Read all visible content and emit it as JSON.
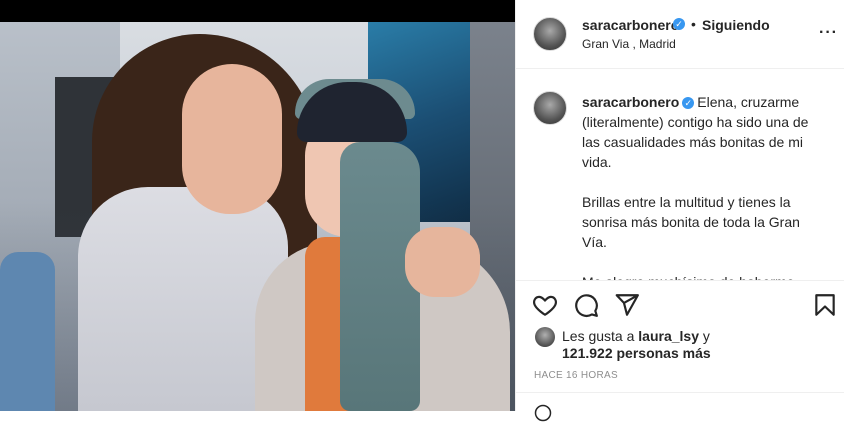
{
  "post": {
    "username": "saracarbonero",
    "follow_status": "Siguiendo",
    "location": "Gran Via , Madrid"
  },
  "caption": {
    "username": "saracarbonero",
    "paragraphs": [
      "Elena, cruzarme (literalmente) contigo ha sido una de las casualidades más bonitas de mi vida.",
      "Brillas entre la multitud y tienes la sonrisa más bonita de toda la Gran Vía.",
      "Me alegro muchísimo de haberme"
    ]
  },
  "likes": {
    "prefix": "Les gusta a",
    "user": "laura_lsy",
    "connector": "y",
    "count_text": "121.922 personas más"
  },
  "time_ago": "HACE 16 HORAS",
  "icons": {
    "verified": "verified-badge-icon",
    "more": "more-options-icon",
    "like": "heart-icon",
    "comment": "comment-icon",
    "share": "paper-plane-icon",
    "save": "bookmark-icon",
    "emoji": "emoji-icon"
  },
  "colors": {
    "verified": "#3897f0",
    "text": "#262626",
    "secondary_text": "#8e8e8e",
    "border": "#efefef"
  }
}
